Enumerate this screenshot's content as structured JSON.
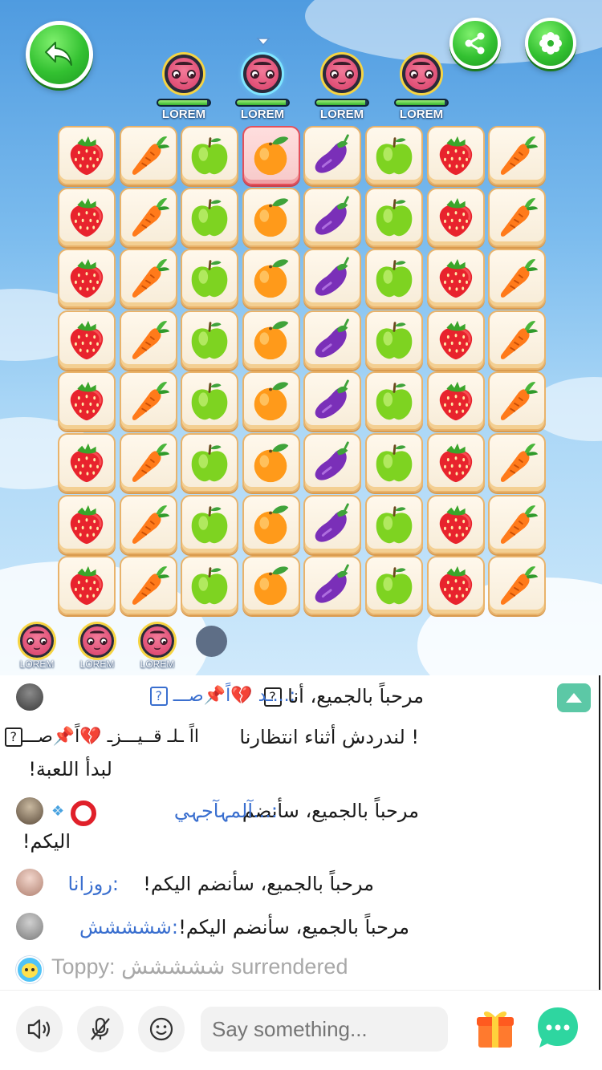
{
  "game": {
    "players": [
      {
        "name": "LOREM",
        "hp": 0.95,
        "active": false
      },
      {
        "name": "LOREM",
        "hp": 0.95,
        "active": true
      },
      {
        "name": "LOREM",
        "hp": 0.95,
        "active": false
      },
      {
        "name": "LOREM",
        "hp": 0.95,
        "active": false
      }
    ],
    "bench": [
      {
        "name": "LOREM"
      },
      {
        "name": "LOREM"
      },
      {
        "name": "LOREM"
      }
    ],
    "board": {
      "rows": 8,
      "columns": [
        "strawberry",
        "carrot",
        "green-apple",
        "orange",
        "eggplant",
        "green-apple",
        "strawberry",
        "carrot"
      ],
      "selected": {
        "row": 0,
        "col": 3
      }
    }
  },
  "chat": {
    "messages": [
      {
        "user": ":...ـد 💔اً📌صـــ",
        "text": "مرحباً بالجميع، أنا"
      },
      {
        "user": "ااً ـلـ قــيـــزـ 💔اً📌صـــ",
        "text": "! لندردش أثناء انتظارنا"
      },
      {
        "text": "لبدأ اللعبة!"
      },
      {
        "user": ":...آلمہآجہي",
        "text": "مرحباً بالجميع، سأنضم"
      },
      {
        "text": "اليكم!"
      },
      {
        "user": ":روزانا",
        "text": "مرحباً بالجميع، سأنضم اليكم!"
      },
      {
        "user": ":ششششش",
        "text": "مرحباً بالجميع، سأنضم اليكم!"
      }
    ],
    "system": "Toppy: ششششش surrendered"
  },
  "input": {
    "placeholder": "Say something..."
  },
  "colors": {
    "accent_green": "#33c131",
    "username_blue": "#3a6fcf",
    "teal": "#5cc8a6"
  }
}
